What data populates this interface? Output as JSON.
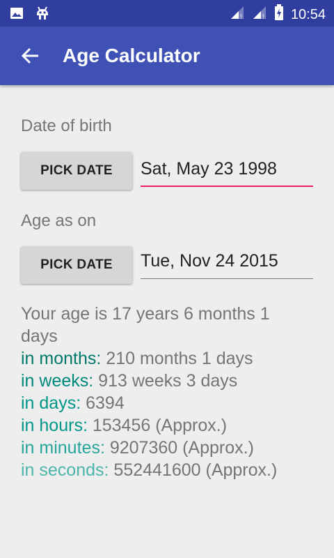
{
  "status_bar": {
    "time": "10:54",
    "icons_left": [
      "image-icon",
      "android-bug-icon"
    ],
    "icons_right": [
      "signal-icon",
      "signal-icon",
      "battery-charging-icon"
    ]
  },
  "app_bar": {
    "title": "Age Calculator",
    "back_icon": "arrow-back-icon"
  },
  "dob": {
    "label": "Date of birth",
    "button_label": "PICK DATE",
    "value": "Sat, May 23 1998"
  },
  "age_on": {
    "label": "Age as on",
    "button_label": "PICK DATE",
    "value": "Tue, Nov 24 2015"
  },
  "results": {
    "summary_line1": "Your age is 17 years 6 months 1",
    "summary_line2": "days",
    "rows": [
      {
        "key": "in months:",
        "value": " 210 months 1 days"
      },
      {
        "key": "in weeks:",
        "value": " 913 weeks 3 days"
      },
      {
        "key": "in days:",
        "value": " 6394"
      },
      {
        "key": "in hours:",
        "value": " 153456 (Approx.)"
      },
      {
        "key": "in minutes:",
        "value": " 9207360 (Approx.)"
      },
      {
        "key": "in seconds:",
        "value": " 552441600 (Approx.)"
      }
    ]
  },
  "colors": {
    "app_bar": "#3f51b5",
    "status_bar": "#303f9f",
    "accent": "#e91e63",
    "teal": "#009688"
  }
}
